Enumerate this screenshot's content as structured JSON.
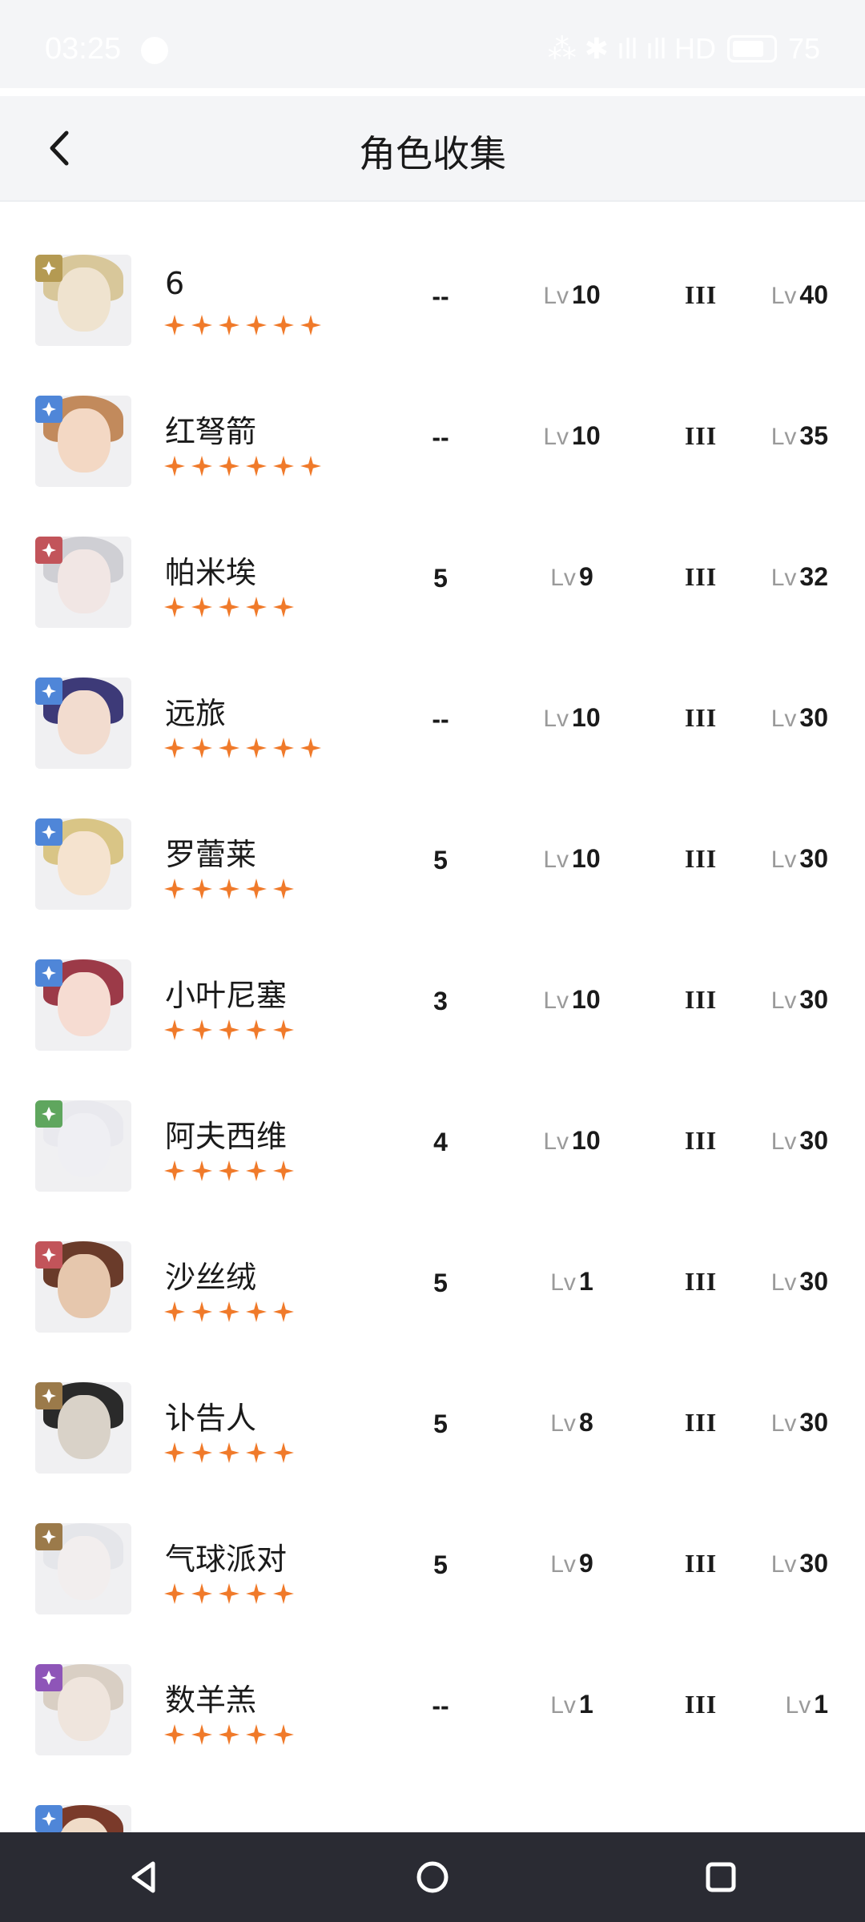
{
  "status_bar": {
    "time": "03:25",
    "indicators": "⁂ ✱ ıll ıll HD",
    "battery": "75"
  },
  "header": {
    "title": "角色收集",
    "back_icon": "chevron-left-icon"
  },
  "colors": {
    "star": "#f07a2a",
    "star_gold": "#ec8a2c",
    "badge_gold": "#b49a52",
    "badge_blue": "#4f86d8",
    "badge_red": "#c2545a",
    "badge_green": "#5fa65e",
    "badge_brown": "#9b7a4a",
    "badge_purple": "#8e55b8"
  },
  "characters": [
    {
      "name": "6",
      "stars": 6,
      "element": "gold",
      "col_a": "--",
      "lv_label": "Lv",
      "lv": "10",
      "tier": "III",
      "lv2_label": "Lv",
      "lv2": "40"
    },
    {
      "name": "红弩箭",
      "stars": 6,
      "element": "blue",
      "col_a": "--",
      "lv_label": "Lv",
      "lv": "10",
      "tier": "III",
      "lv2_label": "Lv",
      "lv2": "35"
    },
    {
      "name": "帕米埃",
      "stars": 5,
      "element": "red",
      "col_a": "5",
      "lv_label": "Lv",
      "lv": "9",
      "tier": "III",
      "lv2_label": "Lv",
      "lv2": "32"
    },
    {
      "name": "远旅",
      "stars": 6,
      "element": "blue",
      "col_a": "--",
      "lv_label": "Lv",
      "lv": "10",
      "tier": "III",
      "lv2_label": "Lv",
      "lv2": "30"
    },
    {
      "name": "罗蕾莱",
      "stars": 5,
      "element": "blue",
      "col_a": "5",
      "lv_label": "Lv",
      "lv": "10",
      "tier": "III",
      "lv2_label": "Lv",
      "lv2": "30"
    },
    {
      "name": "小叶尼塞",
      "stars": 5,
      "element": "blue",
      "col_a": "3",
      "lv_label": "Lv",
      "lv": "10",
      "tier": "III",
      "lv2_label": "Lv",
      "lv2": "30"
    },
    {
      "name": "阿夫西维",
      "stars": 5,
      "element": "green",
      "col_a": "4",
      "lv_label": "Lv",
      "lv": "10",
      "tier": "III",
      "lv2_label": "Lv",
      "lv2": "30"
    },
    {
      "name": "沙丝绒",
      "stars": 5,
      "element": "red",
      "col_a": "5",
      "lv_label": "Lv",
      "lv": "1",
      "tier": "III",
      "lv2_label": "Lv",
      "lv2": "30"
    },
    {
      "name": "讣告人",
      "stars": 5,
      "element": "brown",
      "col_a": "5",
      "lv_label": "Lv",
      "lv": "8",
      "tier": "III",
      "lv2_label": "Lv",
      "lv2": "30"
    },
    {
      "name": "气球派对",
      "stars": 5,
      "element": "brown",
      "col_a": "5",
      "lv_label": "Lv",
      "lv": "9",
      "tier": "III",
      "lv2_label": "Lv",
      "lv2": "30"
    },
    {
      "name": "数羊羔",
      "stars": 5,
      "element": "purple",
      "col_a": "--",
      "lv_label": "Lv",
      "lv": "1",
      "tier": "III",
      "lv2_label": "Lv",
      "lv2": "1"
    },
    {
      "name": "",
      "stars": 0,
      "element": "blue",
      "col_a": "",
      "lv_label": "",
      "lv": "",
      "tier": "",
      "lv2_label": "",
      "lv2": ""
    }
  ],
  "navbar": {
    "back": "triangle-back-icon",
    "home": "circle-home-icon",
    "recents": "square-recents-icon"
  }
}
